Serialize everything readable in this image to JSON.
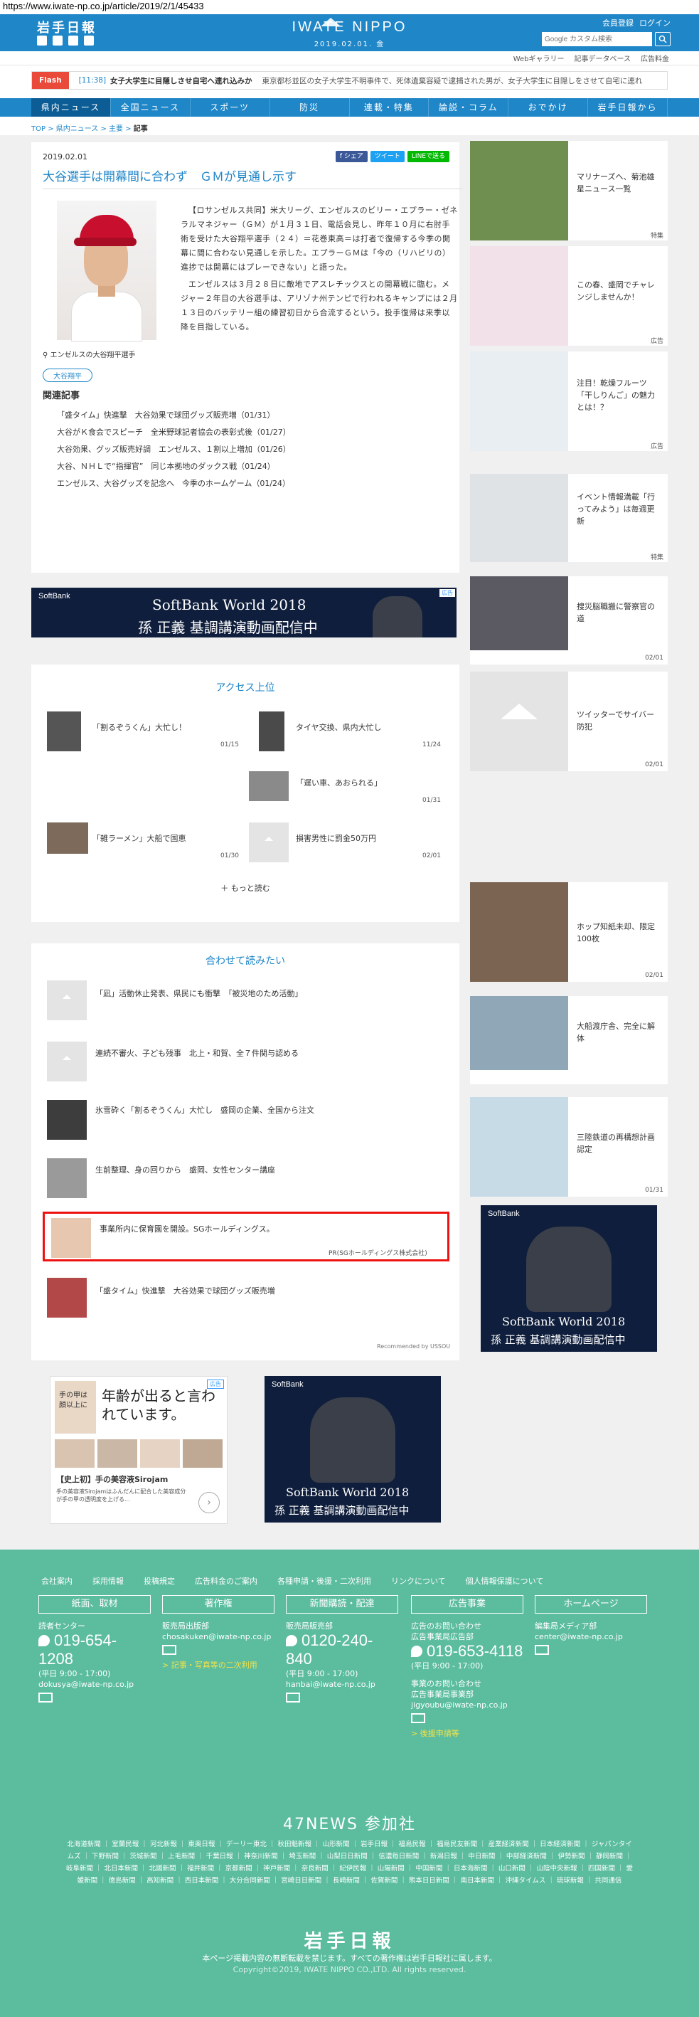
{
  "browser": {
    "url": "https://www.iwate-np.co.jp/article/2019/2/1/45433"
  },
  "header": {
    "logo_jp": "岩手日報",
    "brand": "IWATE NIPPO",
    "date": "2019.02.01. 金",
    "member_link": "会員登録",
    "login_link": "ログイン",
    "search_placeholder": "Google カスタム検索"
  },
  "subnav": [
    "Webギャラリー",
    "記事データベース",
    "広告料金"
  ],
  "flash": {
    "tag": "Flash",
    "time": "[11:38]",
    "headline": "女子大学生に目隠しさせ自宅へ連れ込みか",
    "body": "東京都杉並区の女子大学生不明事件で、死体遺棄容疑で逮捕された男が、女子大学生に目隠しをさせて自宅に連れ"
  },
  "mainnav": [
    "県内ニュース",
    "全国ニュース",
    "スポーツ",
    "防災",
    "連載・特集",
    "論説・コラム",
    "おでかけ",
    "岩手日報から"
  ],
  "breadcrumb": {
    "top": "TOP",
    "c1": "県内ニュース",
    "c2": "主要",
    "current": "記事"
  },
  "article": {
    "date": "2019.02.01",
    "share": [
      "f シェア",
      "ツイート",
      "LINEで送る"
    ],
    "title": "大谷選手は開幕間に合わず　ＧＭが見通し示す",
    "caption": "エンゼルスの大谷翔平選手",
    "p1": "【ロサンゼルス共同】米大リーグ、エンゼルスのビリー・エプラー・ゼネラルマネジャー（ＧＭ）が１月３１日、電話会見し、昨年１０月に右肘手術を受けた大谷翔平選手（２４）＝花巻東高＝は打者で復帰する今季の開幕に間に合わない見通しを示した。エプラーＧＭは「今の（リハビリの）進捗では開幕にはプレーできない」と語った。",
    "p2": "エンゼルスは３月２８日に敵地でアスレチックスとの開幕戦に臨む。メジャー２年目の大谷選手は、アリゾナ州テンピで行われるキャンプには２月１３日のバッテリー組の練習初日から合流するという。投手復帰は来季以降を目指している。",
    "tag": "大谷翔平",
    "related_heading": "関連記事",
    "related": [
      "「盛タイム」快進撃　大谷効果で球団グッズ販売増（01/31）",
      "大谷がＫ食会でスピーチ　全米野球記者協会の表彰式後（01/27）",
      "大谷効果、グッズ販売好調　エンゼルス、１割以上増加（01/26）",
      "大谷、ＮＨＬで“指揮官”　同じ本拠地のダックス戦（01/24）",
      "エンゼルス、大谷グッズを記念へ　今季のホームゲーム（01/24）"
    ]
  },
  "ad_banner": {
    "brand": "SoftBank",
    "line1": "SoftBank World 2018",
    "line2": "孫 正義 基調講演動画配信中",
    "badge": "広告"
  },
  "ranking": {
    "title": "アクセス上位",
    "items": [
      {
        "text": "「割るぞうくん」大忙し！",
        "date": "01/15"
      },
      {
        "text": "タイヤ交換、県内大忙し",
        "date": "11/24"
      },
      {
        "text": "「遅い車、あおられる」",
        "date": "01/31"
      },
      {
        "text": "「雑ラーメン」大船で国恵",
        "date": "01/30"
      },
      {
        "text": "損害男性に罰金50万円",
        "date": "02/01"
      }
    ],
    "more": "もっと読む"
  },
  "recommend": {
    "title": "合わせて読みたい",
    "items": [
      "「凪」活動休止発表、県民にも衝撃　「被災地のため活動」",
      "連続不審火、子ども残事　北上・和賀、全７件関与認める",
      "氷雪砕く「割るぞうくん」大忙し　盛岡の企業、全国から注文",
      "生前整理、身の回りから　盛岡、女性センター講座",
      "事業所内に保育園を開設。SGホールディングス。",
      "「盛タイム」快進撃　大谷効果で球団グッズ販売増"
    ],
    "pr_source": "PR(SGホールディングス株式会社)",
    "powered": "Recommended by USSOU"
  },
  "bottom_ad": {
    "badge": "広告",
    "headline": "年齢が出ると言われています。",
    "small1": "手の甲は",
    "small2": "顔以上に",
    "product": "【史上初】手の美容液Sirojam",
    "desc": "手の美容液Sirojamはふんだんに配合した美容成分が手の甲の透明度を上げる..."
  },
  "sidebar": [
    {
      "text": "マリナーズへ、菊池雄星ニュース一覧",
      "meta": "特集"
    },
    {
      "text": "この春、盛岡でチャレンジしませんか！",
      "meta": "広告"
    },
    {
      "text": "注目！乾燥フルーツ「干しりんご」の魅力とは！？",
      "meta": "広告"
    },
    {
      "text": "イベント情報満載「行ってみよう」は毎週更新",
      "meta": "特集"
    },
    {
      "text": "捜災脳職搬に警察官の道",
      "meta": "02/01"
    },
    {
      "text": "ツイッターでサイバー防犯",
      "meta": "02/01"
    },
    {
      "text": "ホップ知紙未却、限定100枚",
      "meta": "02/01"
    },
    {
      "text": "大船渡庁舎、完全に解体",
      "meta": "02/01"
    },
    {
      "text": "三陸鉄道の再構想計画認定",
      "meta": "01/31"
    }
  ],
  "footer": {
    "links": [
      "会社案内",
      "採用情報",
      "投稿規定",
      "広告料金のご案内",
      "各種申請・後援・二次利用",
      "リンクについて",
      "個人情報保護について"
    ],
    "cols": [
      {
        "btn": "紙面、取材",
        "l1": "読者センター",
        "tel": "019-654-1208",
        "hours": "(平日 9:00 - 17:00)",
        "mail": "dokusya@iwate-np.co.jp",
        "link": ""
      },
      {
        "btn": "著作権",
        "l1": "販売局出版部",
        "tel": "",
        "hours": "",
        "mail": "chosakuken@iwate-np.co.jp",
        "link": "> 記事・写真等の二次利用"
      },
      {
        "btn": "新聞購読・配達",
        "l1": "販売局販売部",
        "tel": "0120-240-840",
        "hours": "(平日 9:00 - 17:00)",
        "mail": "hanbai@iwate-np.co.jp",
        "link": ""
      },
      {
        "btn": "広告事業",
        "l1": "広告のお問い合わせ",
        "l2": "広告事業局広告部",
        "tel": "019-653-4118",
        "hours": "(平日 9:00 - 17:00)",
        "l3": "事業のお問い合わせ",
        "l4": "広告事業局事業部",
        "mail": "jigyoubu@iwate-np.co.jp",
        "link": "> 後援申請等"
      },
      {
        "btn": "ホームページ",
        "l1": "編集局メディア部",
        "tel": "",
        "hours": "",
        "mail": "center@iwate-np.co.jp",
        "link": ""
      }
    ],
    "news47": "47NEWS 参加社",
    "papers": "北海道新聞 ｜ 室蘭民報 ｜ 河北新報 ｜ 東奥日報 ｜ デーリー東北 ｜ 秋田魁新報 ｜ 山形新聞 ｜ 岩手日報 ｜ 福島民報 ｜ 福島民友新聞 ｜ 産業経済新聞 ｜ 日本経済新聞 ｜ ジャパンタイムズ ｜ 下野新聞 ｜ 茨城新聞 ｜ 上毛新聞 ｜ 千葉日報 ｜ 神奈川新聞 ｜ 埼玉新聞 ｜ 山梨日日新聞 ｜ 信濃毎日新聞 ｜ 新潟日報 ｜ 中日新聞 ｜ 中部経済新聞 ｜ 伊勢新聞 ｜ 静岡新聞 ｜ 岐阜新聞 ｜ 北日本新聞 ｜ 北國新聞 ｜ 福井新聞 ｜ 京都新聞 ｜ 神戸新聞 ｜ 奈良新聞 ｜ 紀伊民報 ｜ 山陽新聞 ｜ 中国新聞 ｜ 日本海新聞 ｜ 山口新聞 ｜ 山陰中央新報 ｜ 四国新聞 ｜ 愛媛新聞 ｜ 徳島新聞 ｜ 高知新聞 ｜ 西日本新聞 ｜ 大分合同新聞 ｜ 宮崎日日新聞 ｜ 長崎新聞 ｜ 佐賀新聞 ｜ 熊本日日新聞 ｜ 南日本新聞 ｜ 沖縄タイムス ｜ 琉球新報 ｜ 共同通信",
    "logo": "岩手日報",
    "note": "本ページ掲載内容の無断転載を禁じます。すべての著作権は岩手日報社に属します。",
    "copy": "Copyright©2019, IWATE NIPPO CO.,LTD. All rights reserved."
  }
}
